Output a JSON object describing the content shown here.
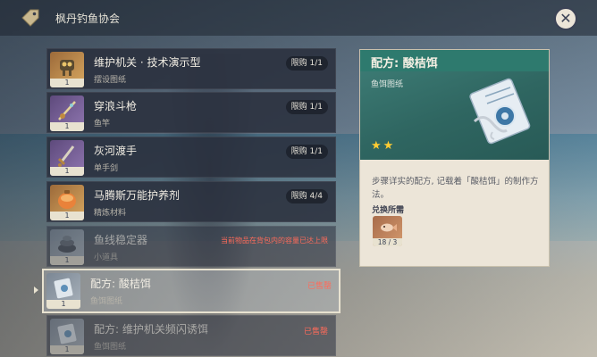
{
  "header": {
    "shop_title": "枫丹钓鱼协会",
    "close_label": "✕"
  },
  "items": [
    {
      "name": "维护机关 · 技术演示型",
      "category": "摆设图纸",
      "qty": "1",
      "limit": "限购 1/1",
      "state": "available",
      "icon": "automaton-icon"
    },
    {
      "name": "穿浪斗枪",
      "category": "鱼竿",
      "qty": "1",
      "limit": "限购 1/1",
      "state": "available",
      "icon": "fishing-rod-icon"
    },
    {
      "name": "灰河渡手",
      "category": "单手剑",
      "qty": "1",
      "limit": "限购 1/1",
      "state": "available",
      "icon": "sword-icon"
    },
    {
      "name": "马腾斯万能护养剂",
      "category": "精炼材料",
      "qty": "1",
      "limit": "限购 4/4",
      "state": "available",
      "icon": "potion-icon"
    },
    {
      "name": "鱼线稳定器",
      "category": "小道具",
      "qty": "1",
      "warning": "当前物品在背包内的容量已达上限",
      "state": "disabled",
      "icon": "line-stabilizer-icon"
    },
    {
      "name": "配方: 酸桔饵",
      "category": "鱼饵图纸",
      "qty": "1",
      "sold": "已售罄",
      "state": "selected",
      "icon": "recipe-icon"
    },
    {
      "name": "配方: 维护机关频闪诱饵",
      "category": "鱼饵图纸",
      "qty": "1",
      "sold": "已售罄",
      "state": "disabled",
      "icon": "recipe-icon"
    }
  ],
  "detail": {
    "title": "配方: 酸桔饵",
    "type": "鱼饵图纸",
    "stars": "★★",
    "rarity": 2,
    "description": "步骤详实的配方, 记载着「酸桔饵」的制作方法。",
    "requirement_label": "兑换所需",
    "requirement_qty": "18 / 3",
    "requirement_icon": "fish-icon"
  },
  "colors": {
    "panel_dark": "#2a303e",
    "detail_header": "#2e7a6e",
    "parchment": "#ece5d8",
    "warning_red": "#ff6b5a",
    "star_gold": "#ffcc32"
  }
}
